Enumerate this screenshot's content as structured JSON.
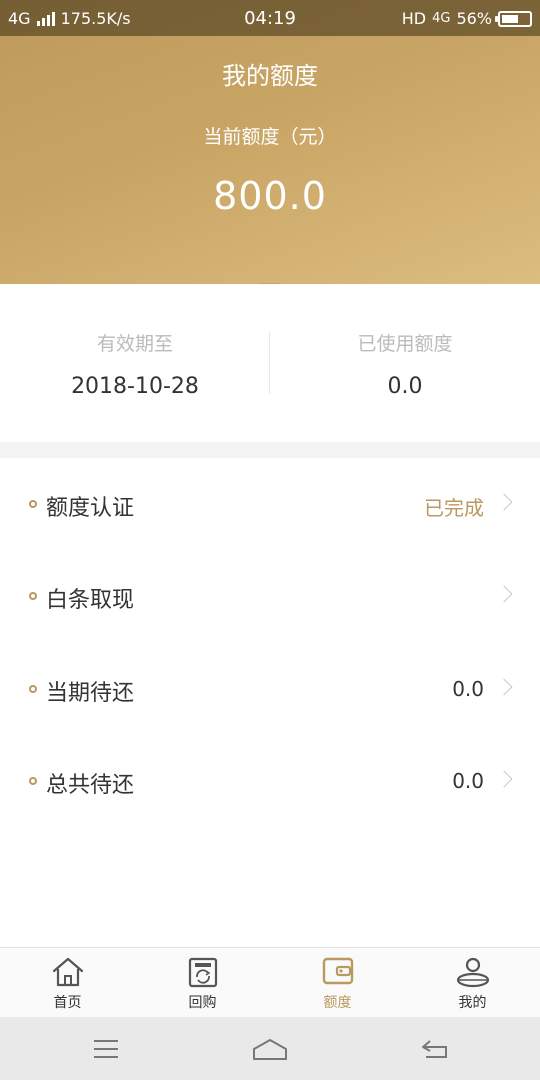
{
  "status_bar": {
    "network_left": "4G",
    "speed": "175.5K/s",
    "time": "04:19",
    "hd": "HD",
    "network_right": "4G",
    "battery": "56%"
  },
  "header": {
    "title": "我的额度",
    "quota_label": "当前额度（元）",
    "quota_value": "800.0"
  },
  "info": {
    "validity_label": "有效期至",
    "validity_value": "2018-10-28",
    "used_label": "已使用额度",
    "used_value": "0.0"
  },
  "list": [
    {
      "label": "额度认证",
      "value": "已完成"
    },
    {
      "label": "白条取现",
      "value": ""
    },
    {
      "label": "当期待还",
      "value": "0.0"
    },
    {
      "label": "总共待还",
      "value": "0.0"
    }
  ],
  "tabs": [
    {
      "label": "首页",
      "icon": "home-icon"
    },
    {
      "label": "回购",
      "icon": "buyback-icon"
    },
    {
      "label": "额度",
      "icon": "wallet-icon"
    },
    {
      "label": "我的",
      "icon": "profile-icon"
    }
  ],
  "colors": {
    "accent": "#b9995f",
    "header_start": "#bd9a5c",
    "header_end": "#dcbd80"
  }
}
